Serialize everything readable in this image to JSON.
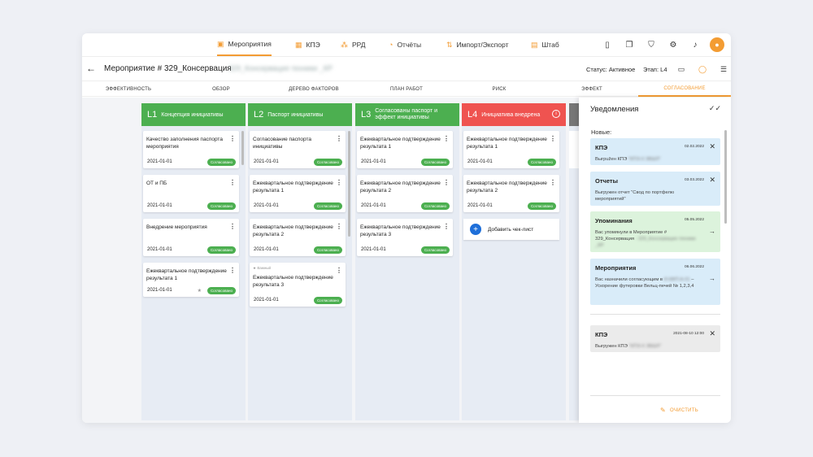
{
  "nav": {
    "items": [
      {
        "label": "Мероприятия",
        "icon": "presentation-icon",
        "glyph": "▣"
      },
      {
        "label": "КПЭ",
        "icon": "grid-icon",
        "glyph": "▦"
      },
      {
        "label": "РРД",
        "icon": "people-icon",
        "glyph": "⁂"
      },
      {
        "label": "Отчёты",
        "icon": "pie-chart-icon",
        "glyph": "◔"
      },
      {
        "label": "Импорт/Экспорт",
        "icon": "swap-icon",
        "glyph": "⇅"
      },
      {
        "label": "Штаб",
        "icon": "calendar-icon",
        "glyph": "▤"
      }
    ],
    "active_index": 0,
    "accent": "#f39c33"
  },
  "header": {
    "title": "Мероприятие # 329_Консервация",
    "subtitle_blurred": "329_Консервация техники _КР",
    "status": "Статус: Активное",
    "stage": "Этап: L4"
  },
  "tabs": [
    "ЭФФЕКТИВНОСТЬ",
    "ОБЗОР",
    "ДЕРЕВО ФАКТОРОВ",
    "ПЛАН РАБОТ",
    "РИСК",
    "ЭФФЕКТ",
    "СОГЛАСОВАНИЕ"
  ],
  "active_tab": 6,
  "columns": [
    {
      "level": "L1",
      "title": "Концепция инициативы",
      "color": "green",
      "cards": [
        {
          "title": "Качество заполнения паспорта мероприятия",
          "date": "2021-01-01",
          "badge": "Согласовано"
        },
        {
          "title": "ОТ и ПБ",
          "date": "2021-01-01",
          "badge": "Согласовано"
        },
        {
          "title": "Внедрение мероприятия",
          "date": "2021-01-01",
          "badge": "Согласовано"
        },
        {
          "title": "Ежеквартальное подтверждение результата 1",
          "date": "2021-01-01",
          "badge": "Согласовано"
        }
      ]
    },
    {
      "level": "L2",
      "title": "Паспорт инициативы",
      "color": "green",
      "cards": [
        {
          "title": "Согласование паспорта инициативы",
          "date": "2021-01-01",
          "badge": "Согласовано"
        },
        {
          "title": "Ежеквартальное подтверждение результата 1",
          "date": "2021-01-01",
          "badge": "Согласовано"
        },
        {
          "title": "Ежеквартальное подтверждение результата 2",
          "date": "2021-01-01",
          "badge": "Согласовано"
        },
        {
          "title": "Ежеквартальное подтверждение результата 3",
          "date": "2021-01-01",
          "badge": "Согласовано",
          "flag": "Важный"
        }
      ]
    },
    {
      "level": "L3",
      "title": "Согласованы паспорт и эффект инициативы",
      "color": "green",
      "cards": [
        {
          "title": "Ежеквартальное подтверждение результата 1",
          "date": "2021-01-01",
          "badge": "Согласовано"
        },
        {
          "title": "Ежеквартальное подтверждение результата 2",
          "date": "2021-01-01",
          "badge": "Согласовано"
        },
        {
          "title": "Ежеквартальное подтверждение результата 3",
          "date": "2021-01-01",
          "badge": "Согласовано"
        }
      ]
    },
    {
      "level": "L4",
      "title": "Инициатива внедрена",
      "color": "red",
      "cards": [
        {
          "title": "Ежеквартальное подтверждение результата 1",
          "date": "2021-01-01",
          "badge": "Согласовано"
        },
        {
          "title": "Ежеквартальное подтверждение результата 2",
          "date": "2021-01-01",
          "badge": "Согласовано"
        }
      ],
      "add_label": "Добавить чек-лист"
    }
  ],
  "notifications": {
    "title": "Уведомления",
    "new_label": "Новые:",
    "items": [
      {
        "heading": "КПЭ",
        "date": "02.02.2022",
        "color": "blue",
        "text": "Выгрužен КПЭ",
        "text_blur": "\"КПЭ-Х ЗВШЛ\"",
        "action": "close"
      },
      {
        "heading": "Отчеты",
        "date": "03.03.2022",
        "color": "blue",
        "text": "Выгружен отчет \"Свод по портфелю мероприятий\"",
        "text_blur": "",
        "action": "close"
      },
      {
        "heading": "Упоминания",
        "date": "05.05.2022",
        "color": "green",
        "text": "Вас упомянули в Мероприятие # 329_Консервация",
        "text_blur": "- 329_Консервация техники _КР",
        "action": "arrow"
      },
      {
        "heading": "Мероприятия",
        "date": "06.06.2022",
        "color": "blue",
        "text": "Вас назначили согласующим в",
        "text_blur": "И-КФП-А-01",
        "text_tail": "– Ускорение футеровки Вельц-печей № 1,2,3,4",
        "action": "arrow"
      }
    ],
    "old": [
      {
        "heading": "КПЭ",
        "date": "2021-08-10 12:00",
        "color": "gray",
        "text": "Выгружен КПЭ",
        "text_blur": "\"КПЭ-Х ЗВШЛ\"",
        "action": "close"
      }
    ],
    "clear_label": "ОЧИСТИТЬ"
  }
}
